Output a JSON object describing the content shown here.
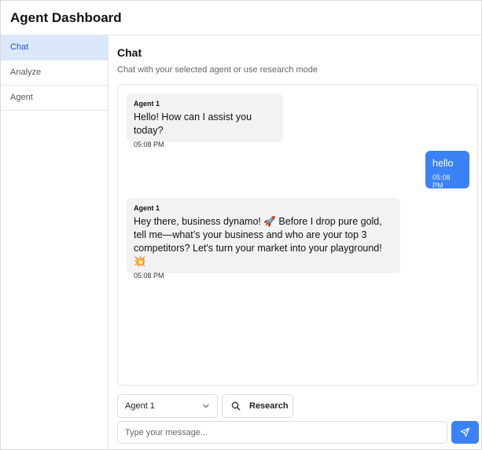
{
  "header": {
    "title": "Agent Dashboard"
  },
  "sidebar": {
    "items": [
      {
        "label": "Chat",
        "active": true
      },
      {
        "label": "Analyze",
        "active": false
      },
      {
        "label": "Agent",
        "active": false
      }
    ]
  },
  "main": {
    "title": "Chat",
    "subtitle": "Chat with your selected agent or use research mode"
  },
  "messages": [
    {
      "role": "agent",
      "sender": "Agent 1",
      "text": "Hello! How can I assist you today?",
      "time": "05:08 PM"
    },
    {
      "role": "user",
      "sender": "",
      "text": "hello",
      "time": "05:08 PM"
    },
    {
      "role": "agent",
      "sender": "Agent 1",
      "text": "Hey there, business dynamo! 🚀 Before I drop pure gold, tell me—what’s your business and who are your top 3 competitors? Let's turn your market into your playground! 💥",
      "time": "05:08 PM"
    }
  ],
  "controls": {
    "agent_select": {
      "value": "Agent 1",
      "icon": "chevron-down-icon"
    },
    "research_button": {
      "label": "Research",
      "icon": "search-icon"
    },
    "message_input": {
      "placeholder": "Type your message...",
      "value": ""
    },
    "send_button": {
      "icon": "send-icon"
    }
  },
  "colors": {
    "accent": "#3b82f6",
    "active_nav_bg": "#dbe8fb",
    "agent_bubble_bg": "#f2f2f2"
  }
}
